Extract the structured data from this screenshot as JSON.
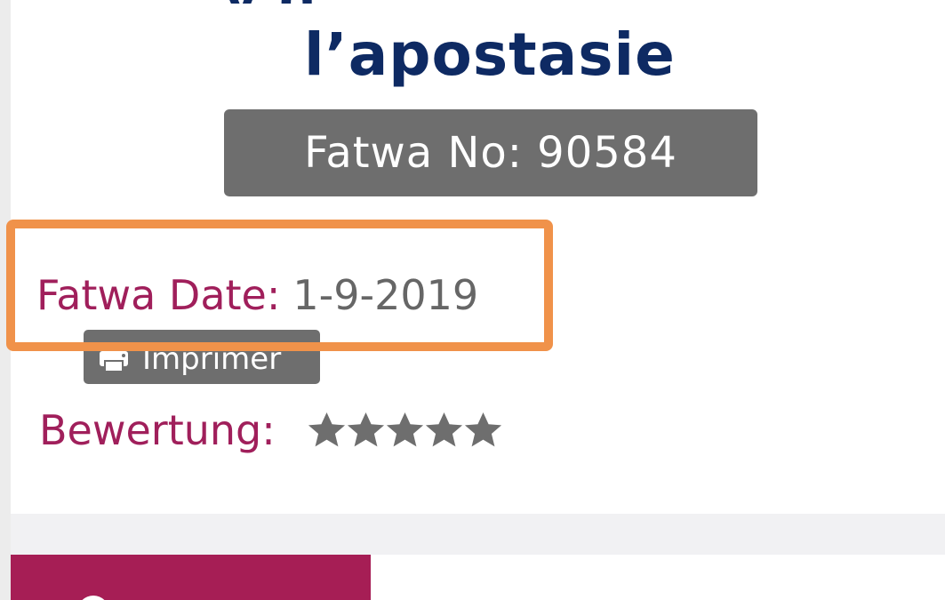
{
  "article": {
    "title_line_fragment": "y g",
    "title_line": "l’apostasie",
    "fatwa_number_label": "Fatwa No: 90584"
  },
  "meta": {
    "date_label": "Fatwa Date:",
    "date_value": "1-9-2019",
    "print_label": "Imprimer",
    "rating_label": "Bewertung:",
    "rating_stars": 5
  },
  "colors": {
    "title": "#0e2a63",
    "accent": "#a01f5b",
    "badge": "#6e6e6e",
    "highlight": "#f0924a",
    "star": "#6e6e6e",
    "tab": "#a61e55"
  },
  "icons": {
    "print": "printer-icon",
    "star": "star-icon"
  }
}
